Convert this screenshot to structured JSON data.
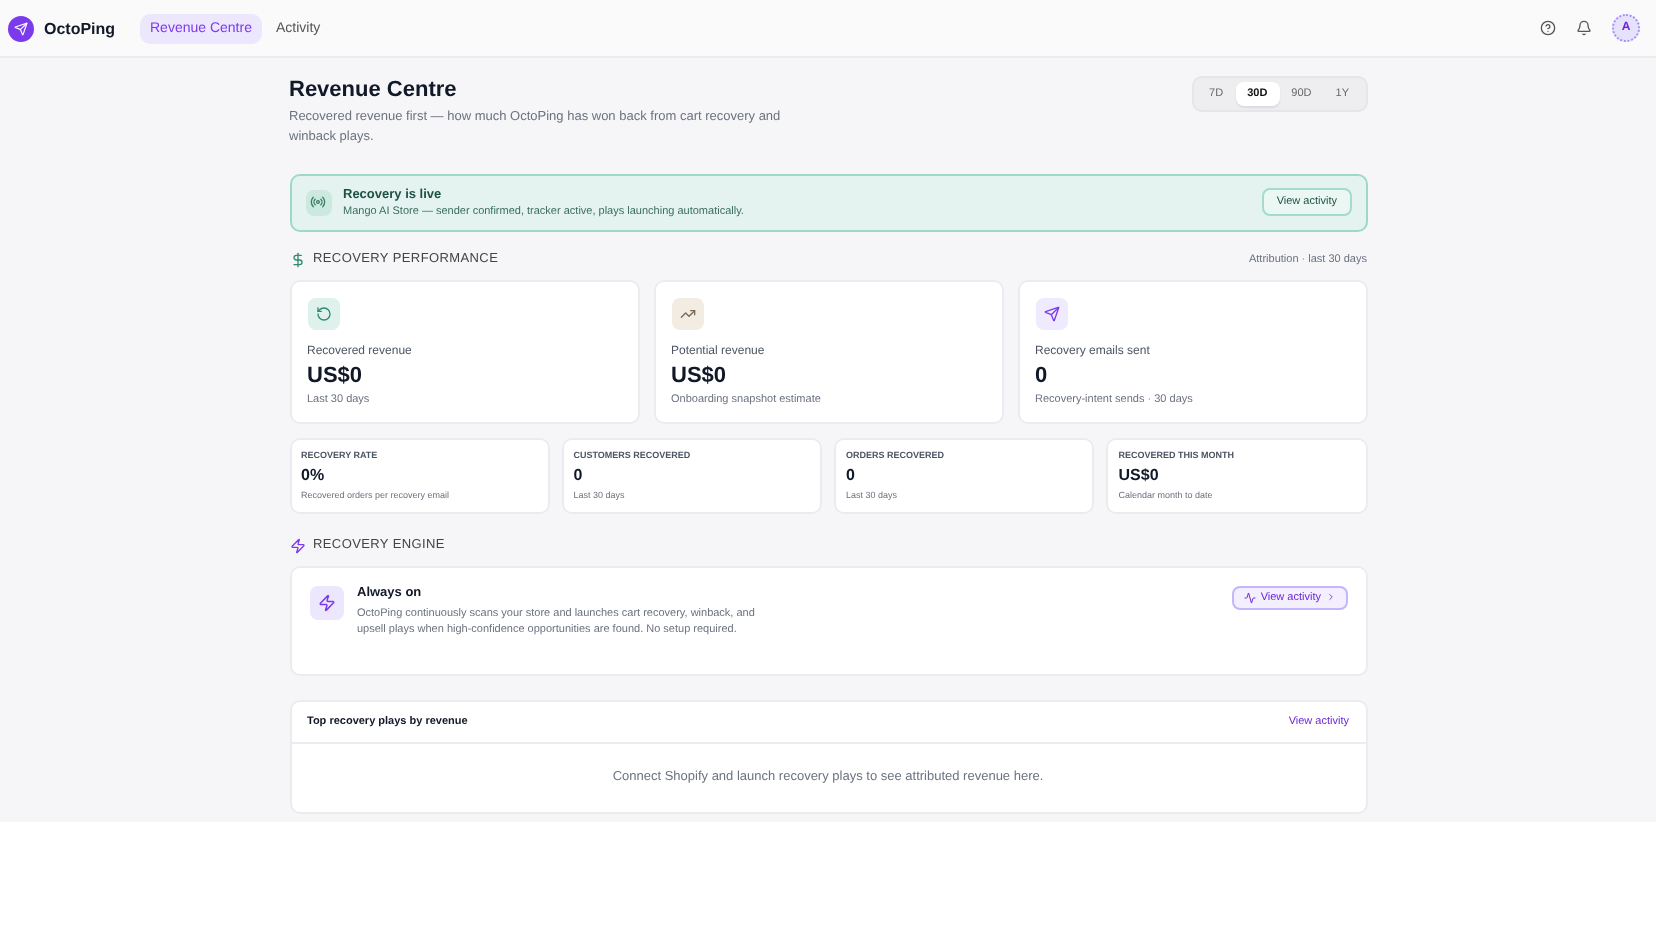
{
  "brand": {
    "name": "OctoPing"
  },
  "nav": [
    {
      "label": "Revenue Centre",
      "selected": true
    },
    {
      "label": "Activity",
      "selected": false
    }
  ],
  "user": {
    "initial": "A"
  },
  "page": {
    "title": "Revenue Centre",
    "subtitle": "Recovered revenue first — how much OctoPing has won back from cart recovery and winback plays."
  },
  "ranges": [
    {
      "label": "7D",
      "selected": false
    },
    {
      "label": "30D",
      "selected": true
    },
    {
      "label": "90D",
      "selected": false
    },
    {
      "label": "1Y",
      "selected": false
    }
  ],
  "banner": {
    "title": "Recovery is live",
    "text": "Mango AI Store — sender confirmed, tracker active, plays launching automatically.",
    "button": "View activity"
  },
  "performance": {
    "heading": "RECOVERY PERFORMANCE",
    "note": "Attribution · last 30 days",
    "cards": [
      {
        "kind": "refresh",
        "label": "Recovered revenue",
        "value": "US$0",
        "caption": "Last 30 days"
      },
      {
        "kind": "trend",
        "label": "Potential revenue",
        "value": "US$0",
        "caption": "Onboarding snapshot estimate"
      },
      {
        "kind": "send",
        "label": "Recovery emails sent",
        "value": "0",
        "caption": "Recovery-intent sends · 30 days"
      }
    ],
    "stats": [
      {
        "label": "RECOVERY RATE",
        "value": "0%",
        "caption": "Recovered orders per recovery email"
      },
      {
        "label": "CUSTOMERS RECOVERED",
        "value": "0",
        "caption": "Last 30 days"
      },
      {
        "label": "ORDERS RECOVERED",
        "value": "0",
        "caption": "Last 30 days"
      },
      {
        "label": "RECOVERED THIS MONTH",
        "value": "US$0",
        "caption": "Calendar month to date"
      }
    ]
  },
  "engine": {
    "heading": "RECOVERY ENGINE",
    "title": "Always on",
    "text": "OctoPing continuously scans your store and launches cart recovery, winback, and upsell plays when high-confidence opportunities are found. No setup required.",
    "button": "View activity"
  },
  "top_plays": {
    "title": "Top recovery plays by revenue",
    "link": "View activity",
    "empty": "Connect Shopify and launch recovery plays to see attributed revenue here."
  }
}
